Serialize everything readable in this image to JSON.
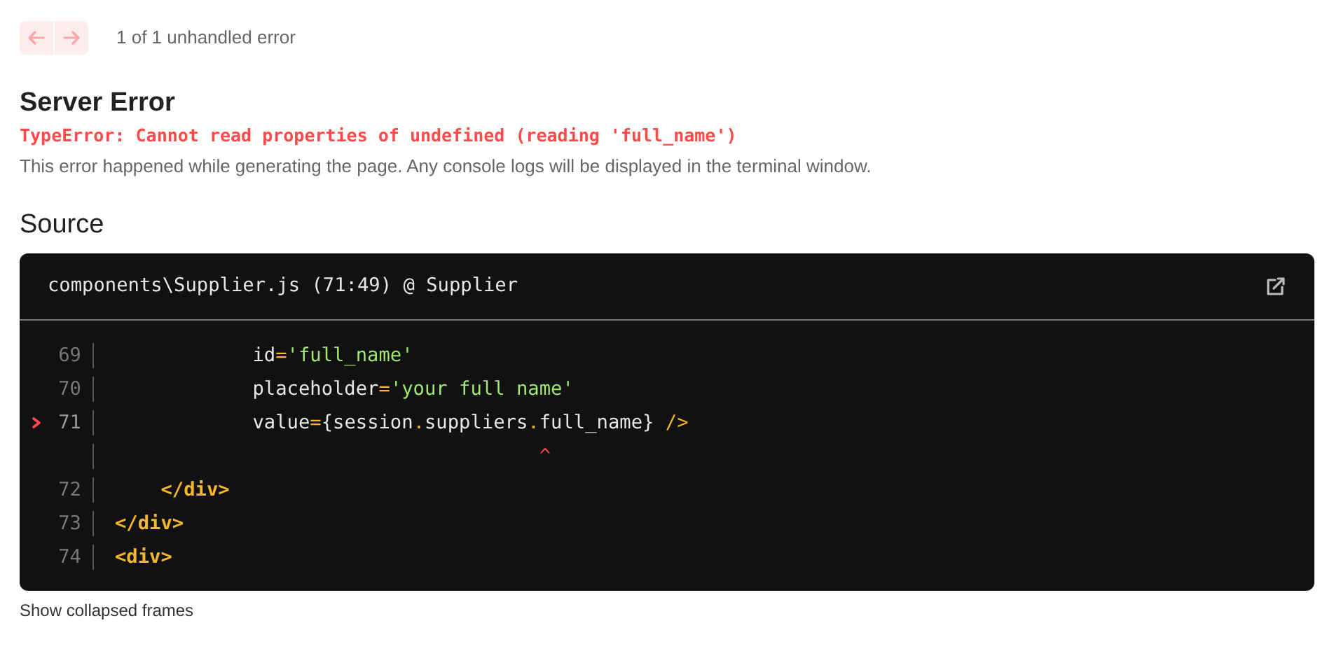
{
  "nav": {
    "previous_disabled": true,
    "next_disabled": true,
    "count": "1 of 1 unhandled error"
  },
  "title": "Server Error",
  "error_message": "TypeError: Cannot read properties of undefined (reading 'full_name')",
  "description": "This error happened while generating the page. Any console logs will be displayed in the terminal window.",
  "section_title": "Source",
  "source": {
    "file": "components\\Supplier.js (71:49) @ Supplier",
    "lines": [
      {
        "kind": "code",
        "number": "69",
        "highlighted": false,
        "tokens": [
          {
            "text": "            id",
            "kind": "plain"
          },
          {
            "text": "=",
            "kind": "punct"
          },
          {
            "text": "'full_name'",
            "kind": "string"
          }
        ]
      },
      {
        "kind": "code",
        "number": "70",
        "highlighted": false,
        "tokens": [
          {
            "text": "            placeholder",
            "kind": "plain"
          },
          {
            "text": "=",
            "kind": "punct"
          },
          {
            "text": "'your full name'",
            "kind": "string"
          }
        ]
      },
      {
        "kind": "code",
        "number": "71",
        "highlighted": true,
        "tokens": [
          {
            "text": "            value",
            "kind": "plain"
          },
          {
            "text": "=",
            "kind": "punct"
          },
          {
            "text": "{session",
            "kind": "plain"
          },
          {
            "text": ".",
            "kind": "punct"
          },
          {
            "text": "suppliers",
            "kind": "plain"
          },
          {
            "text": ".",
            "kind": "punct"
          },
          {
            "text": "full_name} ",
            "kind": "plain"
          },
          {
            "text": "/>",
            "kind": "punct"
          }
        ]
      },
      {
        "kind": "caret",
        "text": "                                     ^"
      },
      {
        "kind": "code",
        "number": "72",
        "highlighted": false,
        "tokens": [
          {
            "text": "    </div>",
            "kind": "tag"
          }
        ]
      },
      {
        "kind": "code",
        "number": "73",
        "highlighted": false,
        "tokens": [
          {
            "text": "</div>",
            "kind": "tag"
          }
        ]
      },
      {
        "kind": "code",
        "number": "74",
        "highlighted": false,
        "tokens": [
          {
            "text": "<div>",
            "kind": "tag"
          }
        ]
      }
    ]
  },
  "footer_link": "Show collapsed frames"
}
